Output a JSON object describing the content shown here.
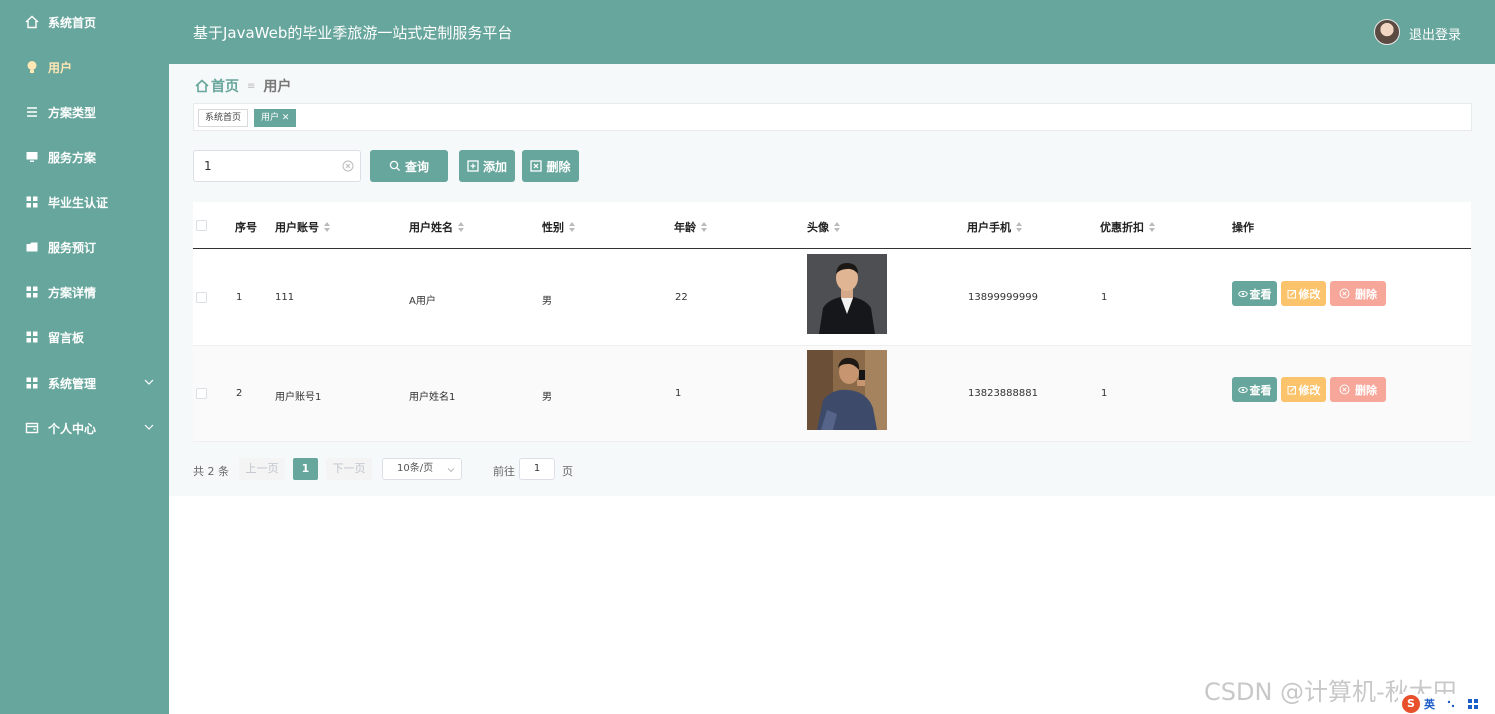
{
  "sidebar": {
    "items": [
      {
        "label": "系统首页",
        "icon": "home-icon"
      },
      {
        "label": "用户",
        "icon": "user-bulb-icon"
      },
      {
        "label": "方案类型",
        "icon": "list-icon"
      },
      {
        "label": "服务方案",
        "icon": "monitor-icon"
      },
      {
        "label": "毕业生认证",
        "icon": "grid-icon"
      },
      {
        "label": "服务预订",
        "icon": "folder-icon"
      },
      {
        "label": "方案详情",
        "icon": "grid-icon"
      },
      {
        "label": "留言板",
        "icon": "grid-icon"
      },
      {
        "label": "系统管理",
        "icon": "grid-icon"
      },
      {
        "label": "个人中心",
        "icon": "wallet-icon"
      }
    ]
  },
  "header": {
    "title": "基于JavaWeb的毕业季旅游一站式定制服务平台",
    "logout_label": "退出登录"
  },
  "breadcrumb": {
    "home": "首页",
    "current": "用户"
  },
  "tags": {
    "home": "系统首页",
    "current": "用户"
  },
  "search": {
    "value": "1",
    "query_label": "查询",
    "add_label": "添加",
    "delete_label": "删除"
  },
  "table": {
    "headers": {
      "index": "序号",
      "account": "用户账号",
      "name": "用户姓名",
      "gender": "性别",
      "age": "年龄",
      "avatar": "头像",
      "phone": "用户手机",
      "discount": "优惠折扣",
      "actions": "操作"
    },
    "rows": [
      {
        "index": "1",
        "account": "111",
        "name": "A用户",
        "gender": "男",
        "age": "22",
        "phone": "13899999999",
        "discount": "1"
      },
      {
        "index": "2",
        "account": "用户账号1",
        "name": "用户姓名1",
        "gender": "男",
        "age": "1",
        "phone": "13823888881",
        "discount": "1"
      }
    ],
    "action_labels": {
      "view": "查看",
      "edit": "修改",
      "delete": "删除"
    }
  },
  "pagination": {
    "total": "共 2 条",
    "prev": "上一页",
    "current": "1",
    "next": "下一页",
    "page_size": "10条/页",
    "goto_label": "前往",
    "goto_value": "1",
    "page_suffix": "页"
  },
  "watermark": "CSDN @计算机-秋大田",
  "ime": {
    "logo": "S",
    "lang": "英"
  },
  "colors": {
    "primary": "#67a69c",
    "edit": "#fbc36b",
    "delete": "#f6a79a",
    "active_menu": "#ffe7b5"
  }
}
